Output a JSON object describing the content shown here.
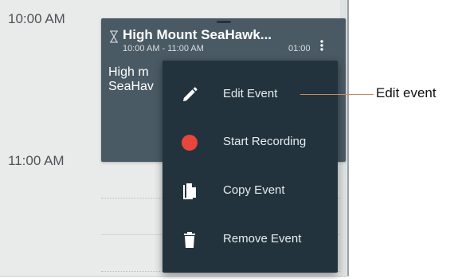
{
  "calendar": {
    "time_labels": [
      "10:00 AM",
      "11:00 AM"
    ]
  },
  "event": {
    "title": "High Mount SeaHawk...",
    "time_range": "10:00 AM - 11:00 AM",
    "duration": "01:00",
    "body_line1": "High m",
    "body_line2": "SeaHav",
    "card_color": "#4a5a64",
    "icons": [
      "hourglass-icon",
      "more-vertical-icon"
    ]
  },
  "menu": {
    "background": "#22333d",
    "items": [
      {
        "label": "Edit Event",
        "icon": "pencil-icon"
      },
      {
        "label": "Start Recording",
        "icon": "record-dot-icon",
        "icon_color": "#e8453c"
      },
      {
        "label": "Copy Event",
        "icon": "copy-icon"
      },
      {
        "label": "Remove Event",
        "icon": "trash-icon"
      }
    ]
  },
  "annotation": {
    "label": "Edit event",
    "line_color": "#c98a5a"
  }
}
